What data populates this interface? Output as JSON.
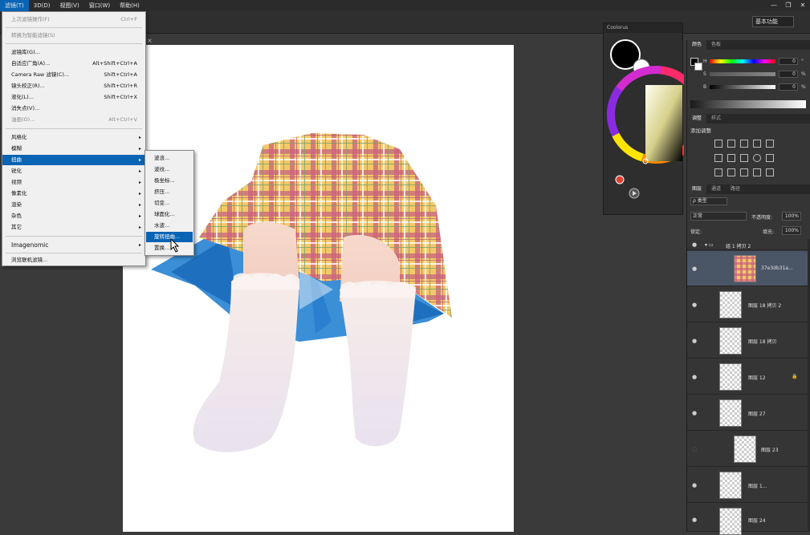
{
  "menubar": {
    "items": [
      "滤镜(T)",
      "3D(D)",
      "视图(V)",
      "窗口(W)",
      "帮助(H)"
    ],
    "window_controls": [
      "—",
      "❐",
      "✕"
    ]
  },
  "options_bar": {
    "workspace": "基本功能"
  },
  "doc_tab": {
    "close": "×"
  },
  "filter_menu": {
    "items": [
      {
        "label": "上次滤镜操作(F)",
        "shortcut": "Ctrl+F",
        "disabled": true
      },
      {
        "label": "转换为智能滤镜(S)",
        "shortcut": "",
        "disabled": true
      },
      {
        "label": "滤镜库(G)...",
        "shortcut": ""
      },
      {
        "label": "自适应广角(A)...",
        "shortcut": "Alt+Shift+Ctrl+A"
      },
      {
        "label": "Camera Raw 滤镜(C)...",
        "shortcut": "Shift+Ctrl+A"
      },
      {
        "label": "镜头校正(R)...",
        "shortcut": "Shift+Ctrl+R"
      },
      {
        "label": "液化(L)...",
        "shortcut": "Shift+Ctrl+X"
      },
      {
        "label": "消失点(V)...",
        "shortcut": ""
      },
      {
        "label": "油画(O)...",
        "shortcut": "Alt+Ctrl+V",
        "disabled": true
      },
      {
        "label": "风格化",
        "arrow": "▸"
      },
      {
        "label": "模糊",
        "arrow": "▸"
      },
      {
        "label": "扭曲",
        "arrow": "▸",
        "highlight": true
      },
      {
        "label": "锐化",
        "arrow": "▸"
      },
      {
        "label": "视频",
        "arrow": "▸"
      },
      {
        "label": "像素化",
        "arrow": "▸"
      },
      {
        "label": "渲染",
        "arrow": "▸"
      },
      {
        "label": "杂色",
        "arrow": "▸"
      },
      {
        "label": "其它",
        "arrow": "▸"
      },
      {
        "label": "Imagenomic",
        "arrow": "▸"
      },
      {
        "label": "浏览联机滤镜..."
      }
    ]
  },
  "distort_submenu": {
    "items": [
      "波浪...",
      "波纹...",
      "极坐标...",
      "挤压...",
      "切变...",
      "球面化...",
      "水波...",
      "旋转扭曲...",
      "置换..."
    ],
    "highlight_index": 7
  },
  "color_panel": {
    "title": "Coolorus"
  },
  "rgb_panel": {
    "tabs": [
      "颜色",
      "色板"
    ],
    "sliders": [
      {
        "label": "H",
        "value": "0",
        "unit": "°"
      },
      {
        "label": "S",
        "value": "0",
        "unit": "%"
      },
      {
        "label": "B",
        "value": "0",
        "unit": "%"
      }
    ]
  },
  "adjustments": {
    "tabs": [
      "调整",
      "样式"
    ],
    "title": "添加调整"
  },
  "layers": {
    "tabs": [
      "图层",
      "通道",
      "路径"
    ],
    "kind_label": "ρ 类型",
    "blend_mode": "正常",
    "opacity_label": "不透明度:",
    "opacity_value": "100%",
    "lock_label": "锁定:",
    "fill_label": "填充:",
    "fill_value": "100%",
    "group_name": "组 1 拷贝 2",
    "rows": [
      {
        "name": "37e3db31a...",
        "selected": true
      },
      {
        "name": "图层 18 拷贝 2"
      },
      {
        "name": "图层 18 拷贝"
      },
      {
        "name": "图层 12",
        "lock": "🔒"
      },
      {
        "name": "图层 27"
      },
      {
        "name": "图层 23"
      },
      {
        "name": "图层 1..."
      },
      {
        "name": "图层 24"
      }
    ]
  },
  "colors": {
    "accent": "#0a64b4",
    "foreground": "#000000",
    "background": "#ffffff"
  }
}
